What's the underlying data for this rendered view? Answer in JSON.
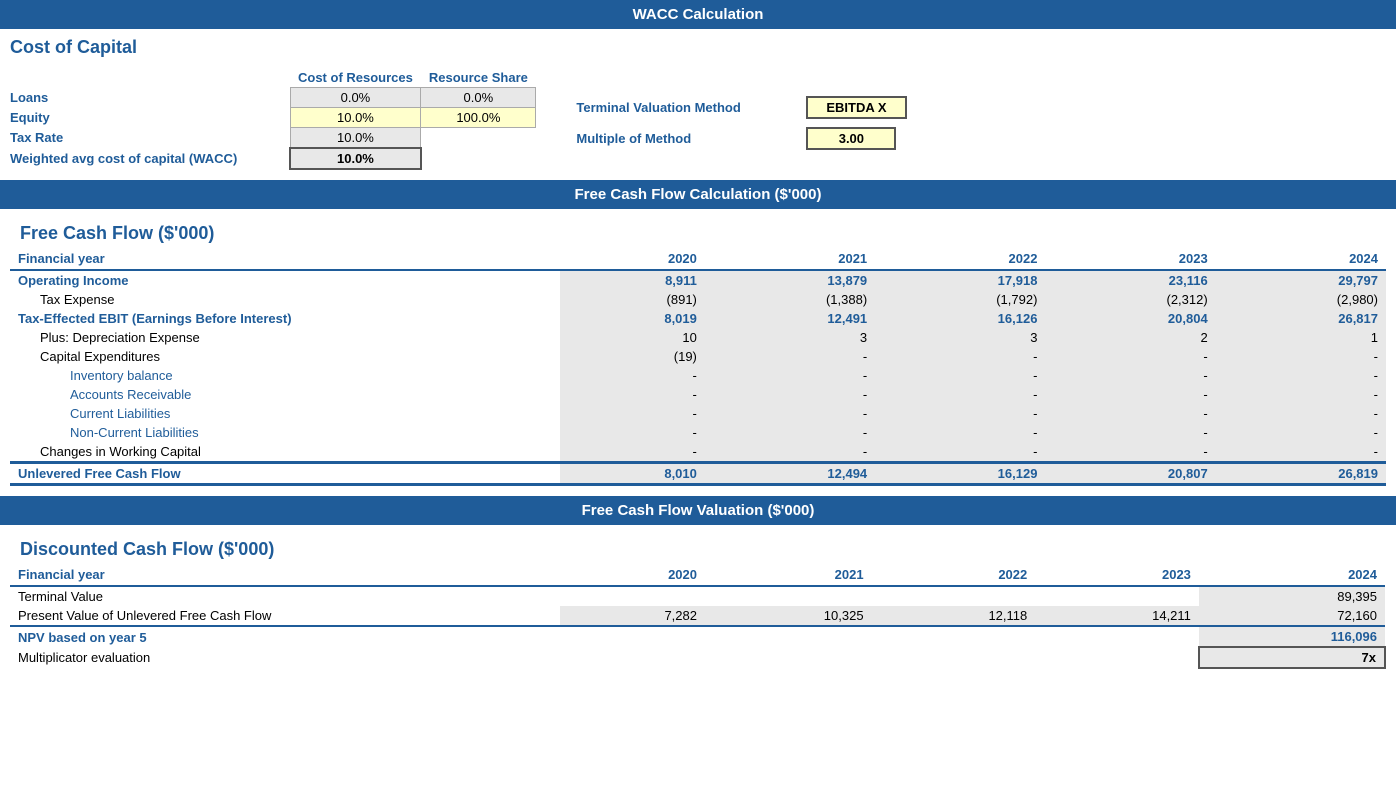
{
  "page": {
    "main_title": "WACC Calculation",
    "cost_of_capital": {
      "section_title": "Cost of Capital",
      "table_headers": [
        "Cost of Resources",
        "Resource Share"
      ],
      "rows": [
        {
          "label": "Loans",
          "cost": "0.0%",
          "share": "0.0%"
        },
        {
          "label": "Equity",
          "cost": "10.0%",
          "share": "100.0%"
        },
        {
          "label": "Tax Rate",
          "cost": "10.0%",
          "share": ""
        },
        {
          "label": "Weighted avg cost of capital (WACC)",
          "cost": "10.0%",
          "share": ""
        }
      ],
      "terminal_label1": "Terminal Valuation Method",
      "terminal_value1": "EBITDA X",
      "terminal_label2": "Multiple of Method",
      "terminal_value2": "3.00"
    },
    "fcf_section": {
      "section_header": "Free Cash Flow Calculation ($'000)",
      "subsection_title": "Free Cash Flow ($'000)",
      "columns": [
        "Financial year",
        "2020",
        "2021",
        "2022",
        "2023",
        "2024"
      ],
      "rows": [
        {
          "label": "Operating Income",
          "type": "bold",
          "values": [
            "8,911",
            "13,879",
            "17,918",
            "23,116",
            "29,797"
          ]
        },
        {
          "label": "Tax Expense",
          "type": "indent1",
          "values": [
            "(891)",
            "(1,388)",
            "(1,792)",
            "(2,312)",
            "(2,980)"
          ]
        },
        {
          "label": "Tax-Effected EBIT (Earnings Before Interest)",
          "type": "bold",
          "values": [
            "8,019",
            "12,491",
            "16,126",
            "20,804",
            "26,817"
          ]
        },
        {
          "label": "Plus: Depreciation Expense",
          "type": "indent1",
          "values": [
            "10",
            "3",
            "3",
            "2",
            "1"
          ]
        },
        {
          "label": "Capital Expenditures",
          "type": "indent1",
          "values": [
            "(19)",
            "-",
            "-",
            "-",
            "-"
          ]
        },
        {
          "label": "Inventory balance",
          "type": "indent2",
          "values": [
            "-",
            "-",
            "-",
            "-",
            "-"
          ]
        },
        {
          "label": "Accounts Receivable",
          "type": "indent2",
          "values": [
            "-",
            "-",
            "-",
            "-",
            "-"
          ]
        },
        {
          "label": "Current Liabilities",
          "type": "indent2",
          "values": [
            "-",
            "-",
            "-",
            "-",
            "-"
          ]
        },
        {
          "label": "Non-Current Liabilities",
          "type": "indent2",
          "values": [
            "-",
            "-",
            "-",
            "-",
            "-"
          ]
        },
        {
          "label": "Changes in Working Capital",
          "type": "indent1",
          "values": [
            "-",
            "-",
            "-",
            "-",
            "-"
          ]
        },
        {
          "label": "Unlevered Free Cash Flow",
          "type": "unlevered",
          "values": [
            "8,010",
            "12,494",
            "16,129",
            "20,807",
            "26,819"
          ]
        }
      ]
    },
    "dcf_section": {
      "section_header": "Free Cash Flow Valuation ($'000)",
      "subsection_title": "Discounted Cash Flow ($'000)",
      "columns": [
        "Financial year",
        "2020",
        "2021",
        "2022",
        "2023",
        "2024"
      ],
      "rows": [
        {
          "label": "Terminal Value",
          "type": "normal",
          "values": [
            "",
            "",
            "",
            "",
            "89,395"
          ]
        },
        {
          "label": "Present Value of Unlevered Free Cash Flow",
          "type": "normal",
          "values": [
            "7,282",
            "10,325",
            "12,118",
            "14,211",
            "72,160"
          ]
        }
      ],
      "npv_label": "NPV based on year 5",
      "npv_value": "116,096",
      "mult_label": "Multiplicator evaluation",
      "mult_value": "7x"
    }
  }
}
